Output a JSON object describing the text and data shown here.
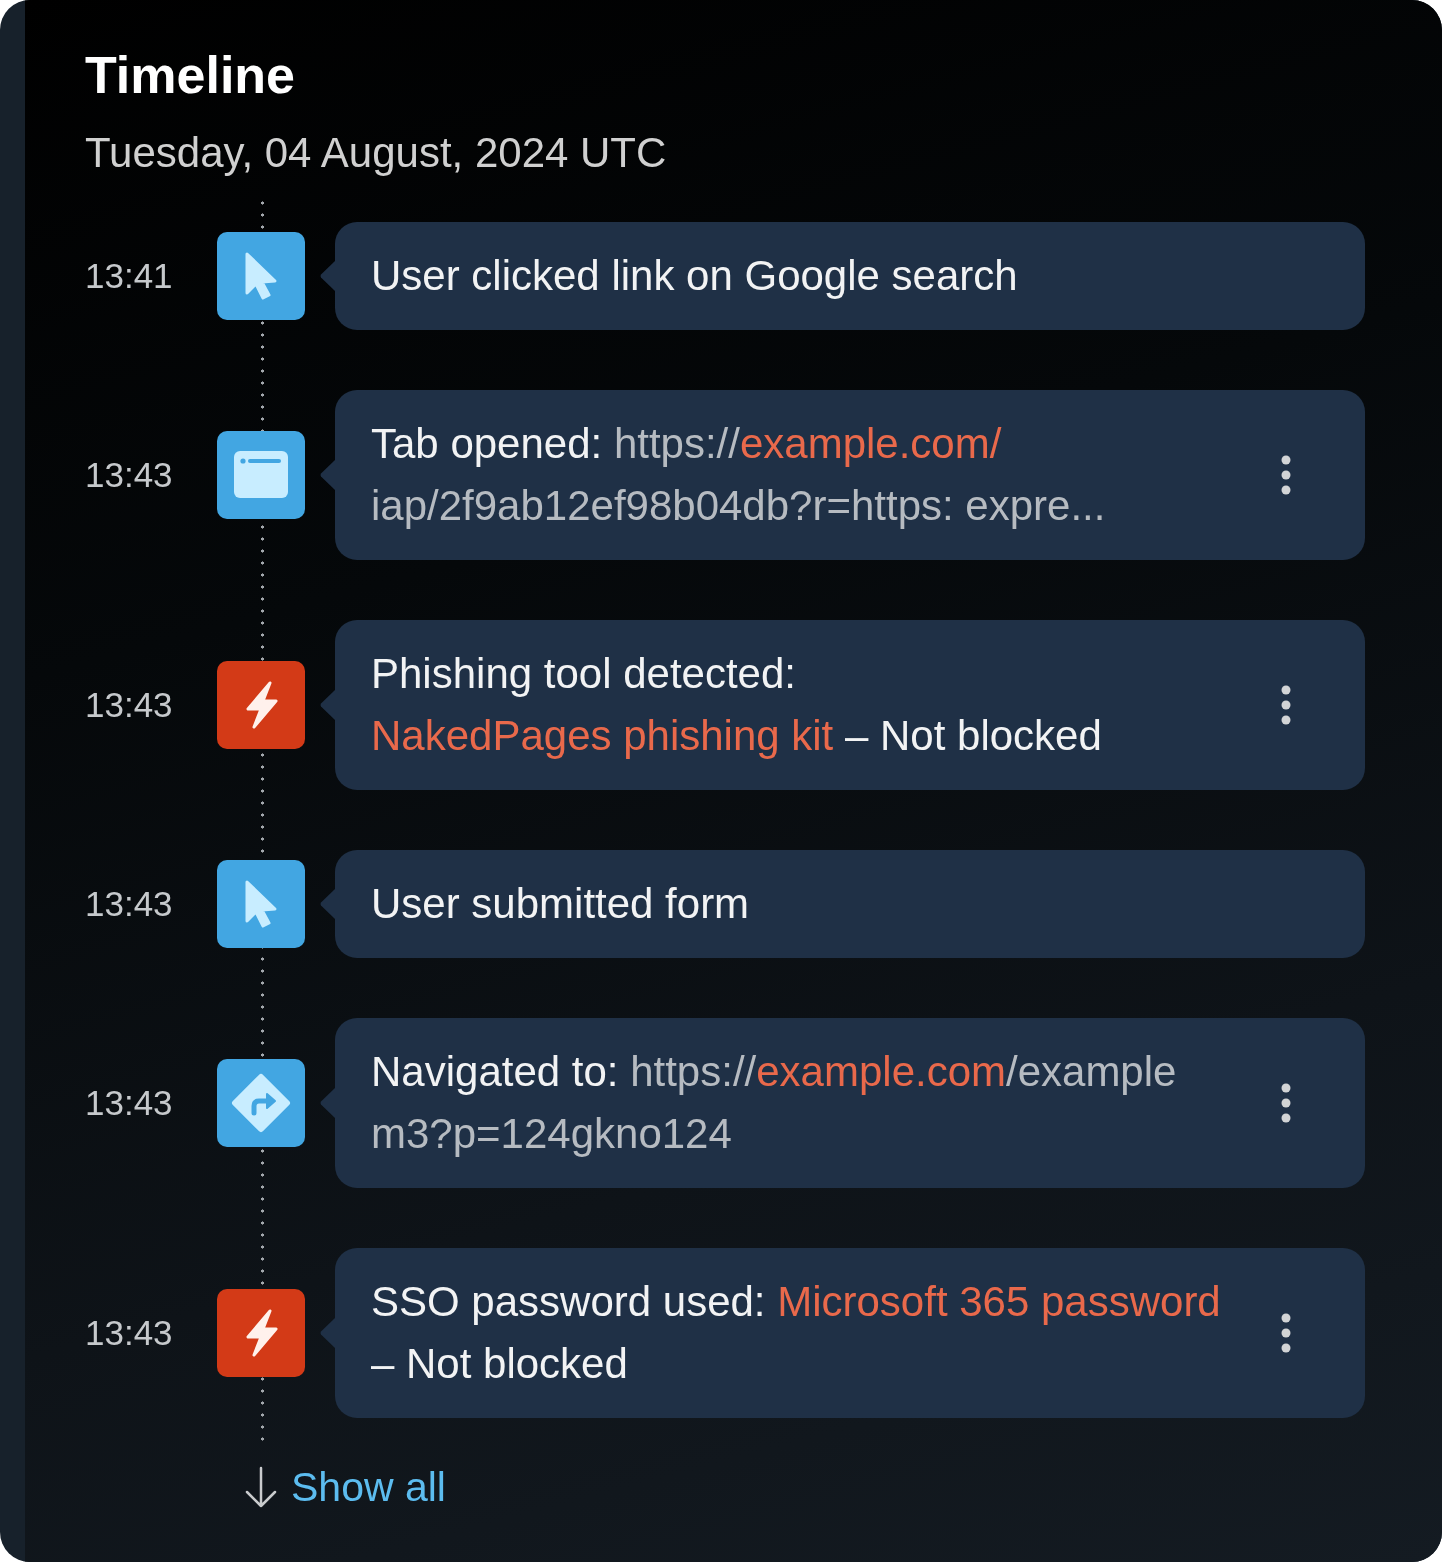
{
  "title": "Timeline",
  "date": "Tuesday, 04 August, 2024 UTC",
  "events": [
    {
      "time": "13:41",
      "kind": "click",
      "lines": [
        [
          {
            "text": "User clicked link on Google search",
            "kind": "label"
          }
        ]
      ],
      "menu": false
    },
    {
      "time": "13:43",
      "kind": "tab",
      "lines": [
        [
          {
            "text": "Tab opened: ",
            "kind": "label"
          },
          {
            "text": "https://",
            "kind": "url"
          },
          {
            "text": "example.com/",
            "kind": "highlight"
          }
        ],
        [
          {
            "text": "iap/2f9ab12ef98b04db?r=https: expre...",
            "kind": "url"
          }
        ]
      ],
      "menu": true
    },
    {
      "time": "13:43",
      "kind": "threat",
      "lines": [
        [
          {
            "text": "Phishing tool detected:",
            "kind": "label"
          }
        ],
        [
          {
            "text": "NakedPages phishing kit",
            "kind": "highlight"
          },
          {
            "text": " – Not blocked",
            "kind": "label"
          }
        ]
      ],
      "menu": true
    },
    {
      "time": "13:43",
      "kind": "click",
      "lines": [
        [
          {
            "text": "User submitted form",
            "kind": "label"
          }
        ]
      ],
      "menu": false
    },
    {
      "time": "13:43",
      "kind": "navigate",
      "lines": [
        [
          {
            "text": "Navigated to: ",
            "kind": "label"
          },
          {
            "text": "https://",
            "kind": "url"
          },
          {
            "text": "example.com",
            "kind": "highlight"
          },
          {
            "text": "/example",
            "kind": "url"
          }
        ],
        [
          {
            "text": "m3?p=124gkno124",
            "kind": "url"
          }
        ]
      ],
      "menu": true
    },
    {
      "time": "13:43",
      "kind": "threat",
      "lines": [
        [
          {
            "text": "SSO password used: ",
            "kind": "label"
          },
          {
            "text": "Microsoft 365 password",
            "kind": "highlight"
          }
        ],
        [
          {
            "text": "– Not blocked",
            "kind": "label"
          }
        ]
      ],
      "menu": true
    }
  ],
  "show_all": "Show all"
}
